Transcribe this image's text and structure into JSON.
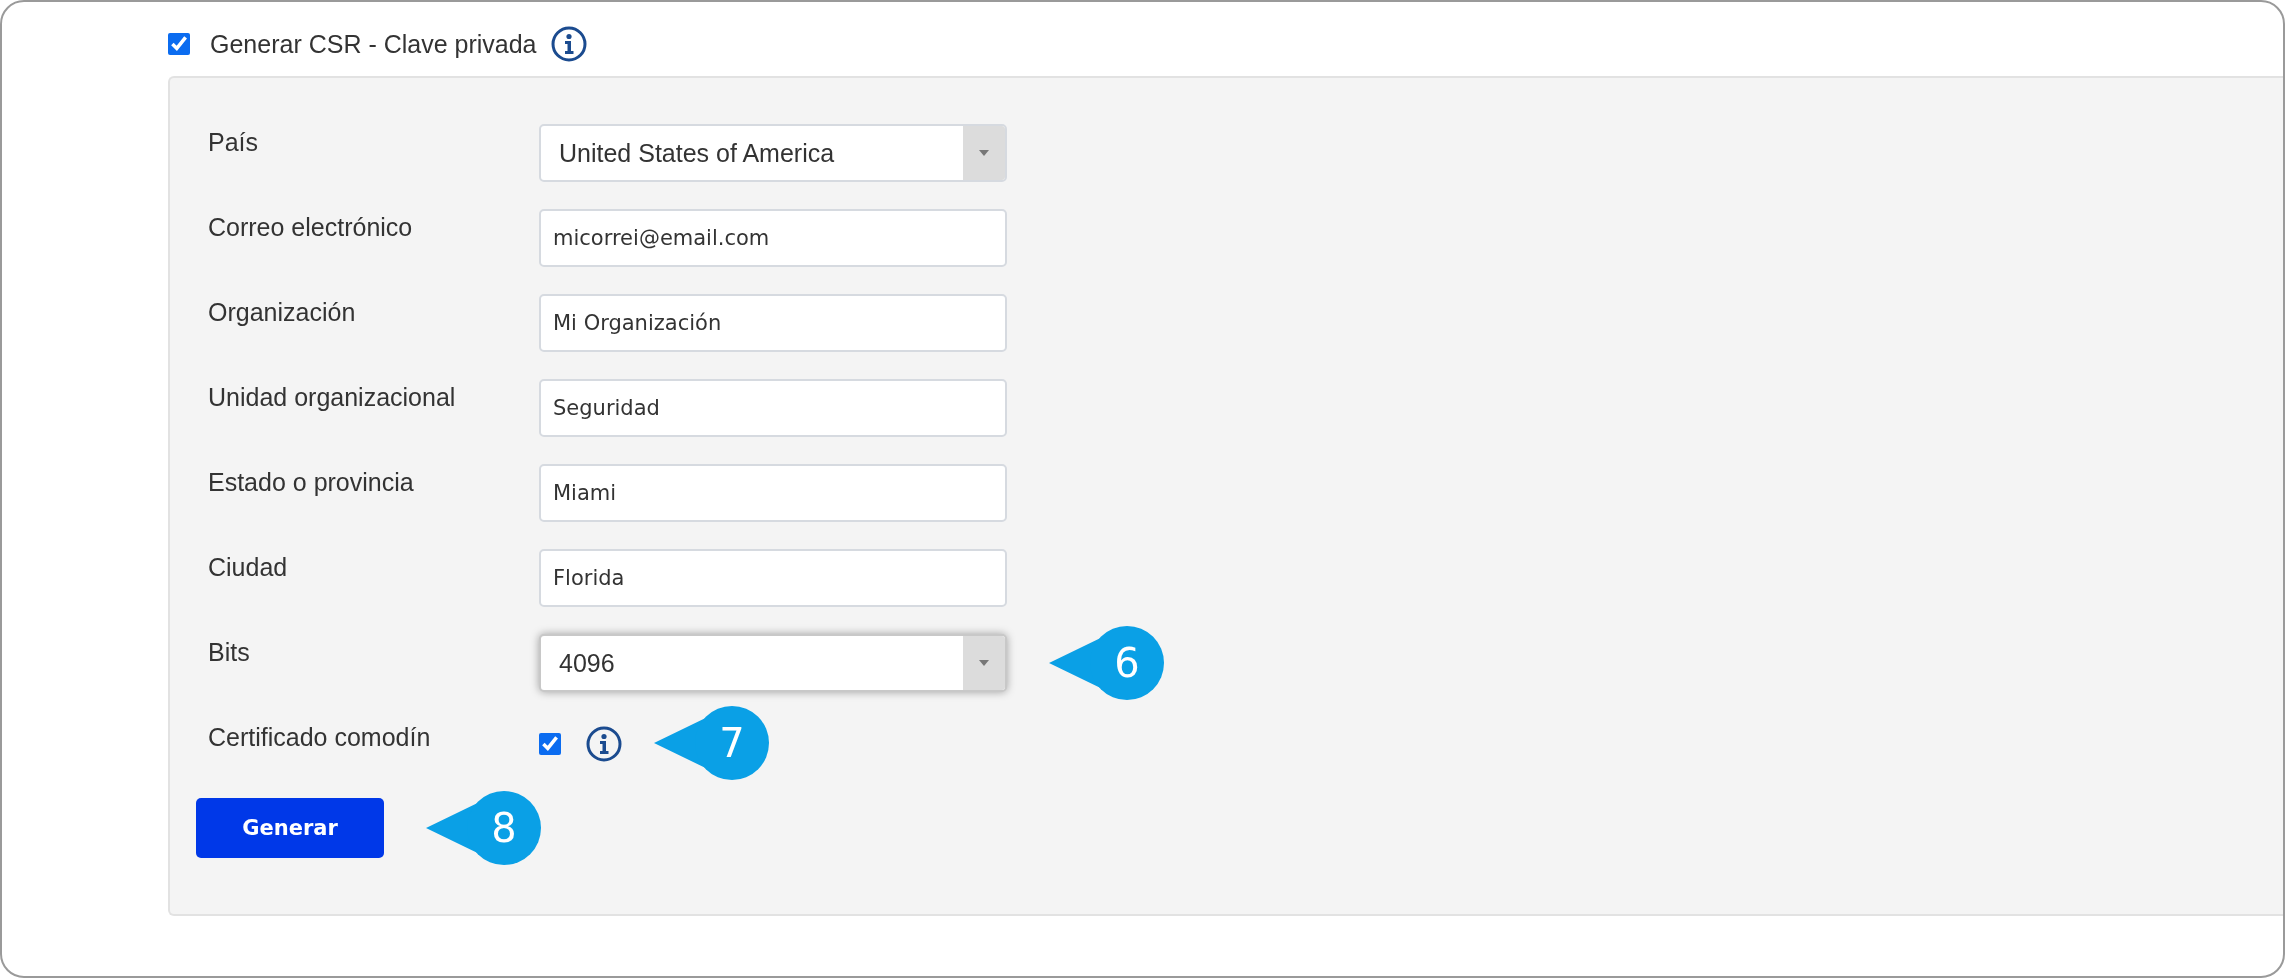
{
  "header": {
    "label": "Generar CSR - Clave privada",
    "checked": true
  },
  "fields": [
    {
      "kind": "select",
      "label": "País",
      "value": "United States of America",
      "focused": false
    },
    {
      "kind": "text",
      "label": "Correo electrónico",
      "value": "micorrei@email.com"
    },
    {
      "kind": "text",
      "label": "Organización",
      "value": "Mi Organización"
    },
    {
      "kind": "text",
      "label": "Unidad organizacional",
      "value": "Seguridad"
    },
    {
      "kind": "text",
      "label": "Estado o provincia",
      "value": "Miami"
    },
    {
      "kind": "text",
      "label": "Ciudad",
      "value": "Florida"
    },
    {
      "kind": "select",
      "label": "Bits",
      "value": "4096",
      "focused": true,
      "callout": "6"
    },
    {
      "kind": "checkbox",
      "label": "Certificado comodín",
      "checked": true,
      "callout": "7"
    }
  ],
  "button": {
    "label": "Generar",
    "callout": "8"
  }
}
